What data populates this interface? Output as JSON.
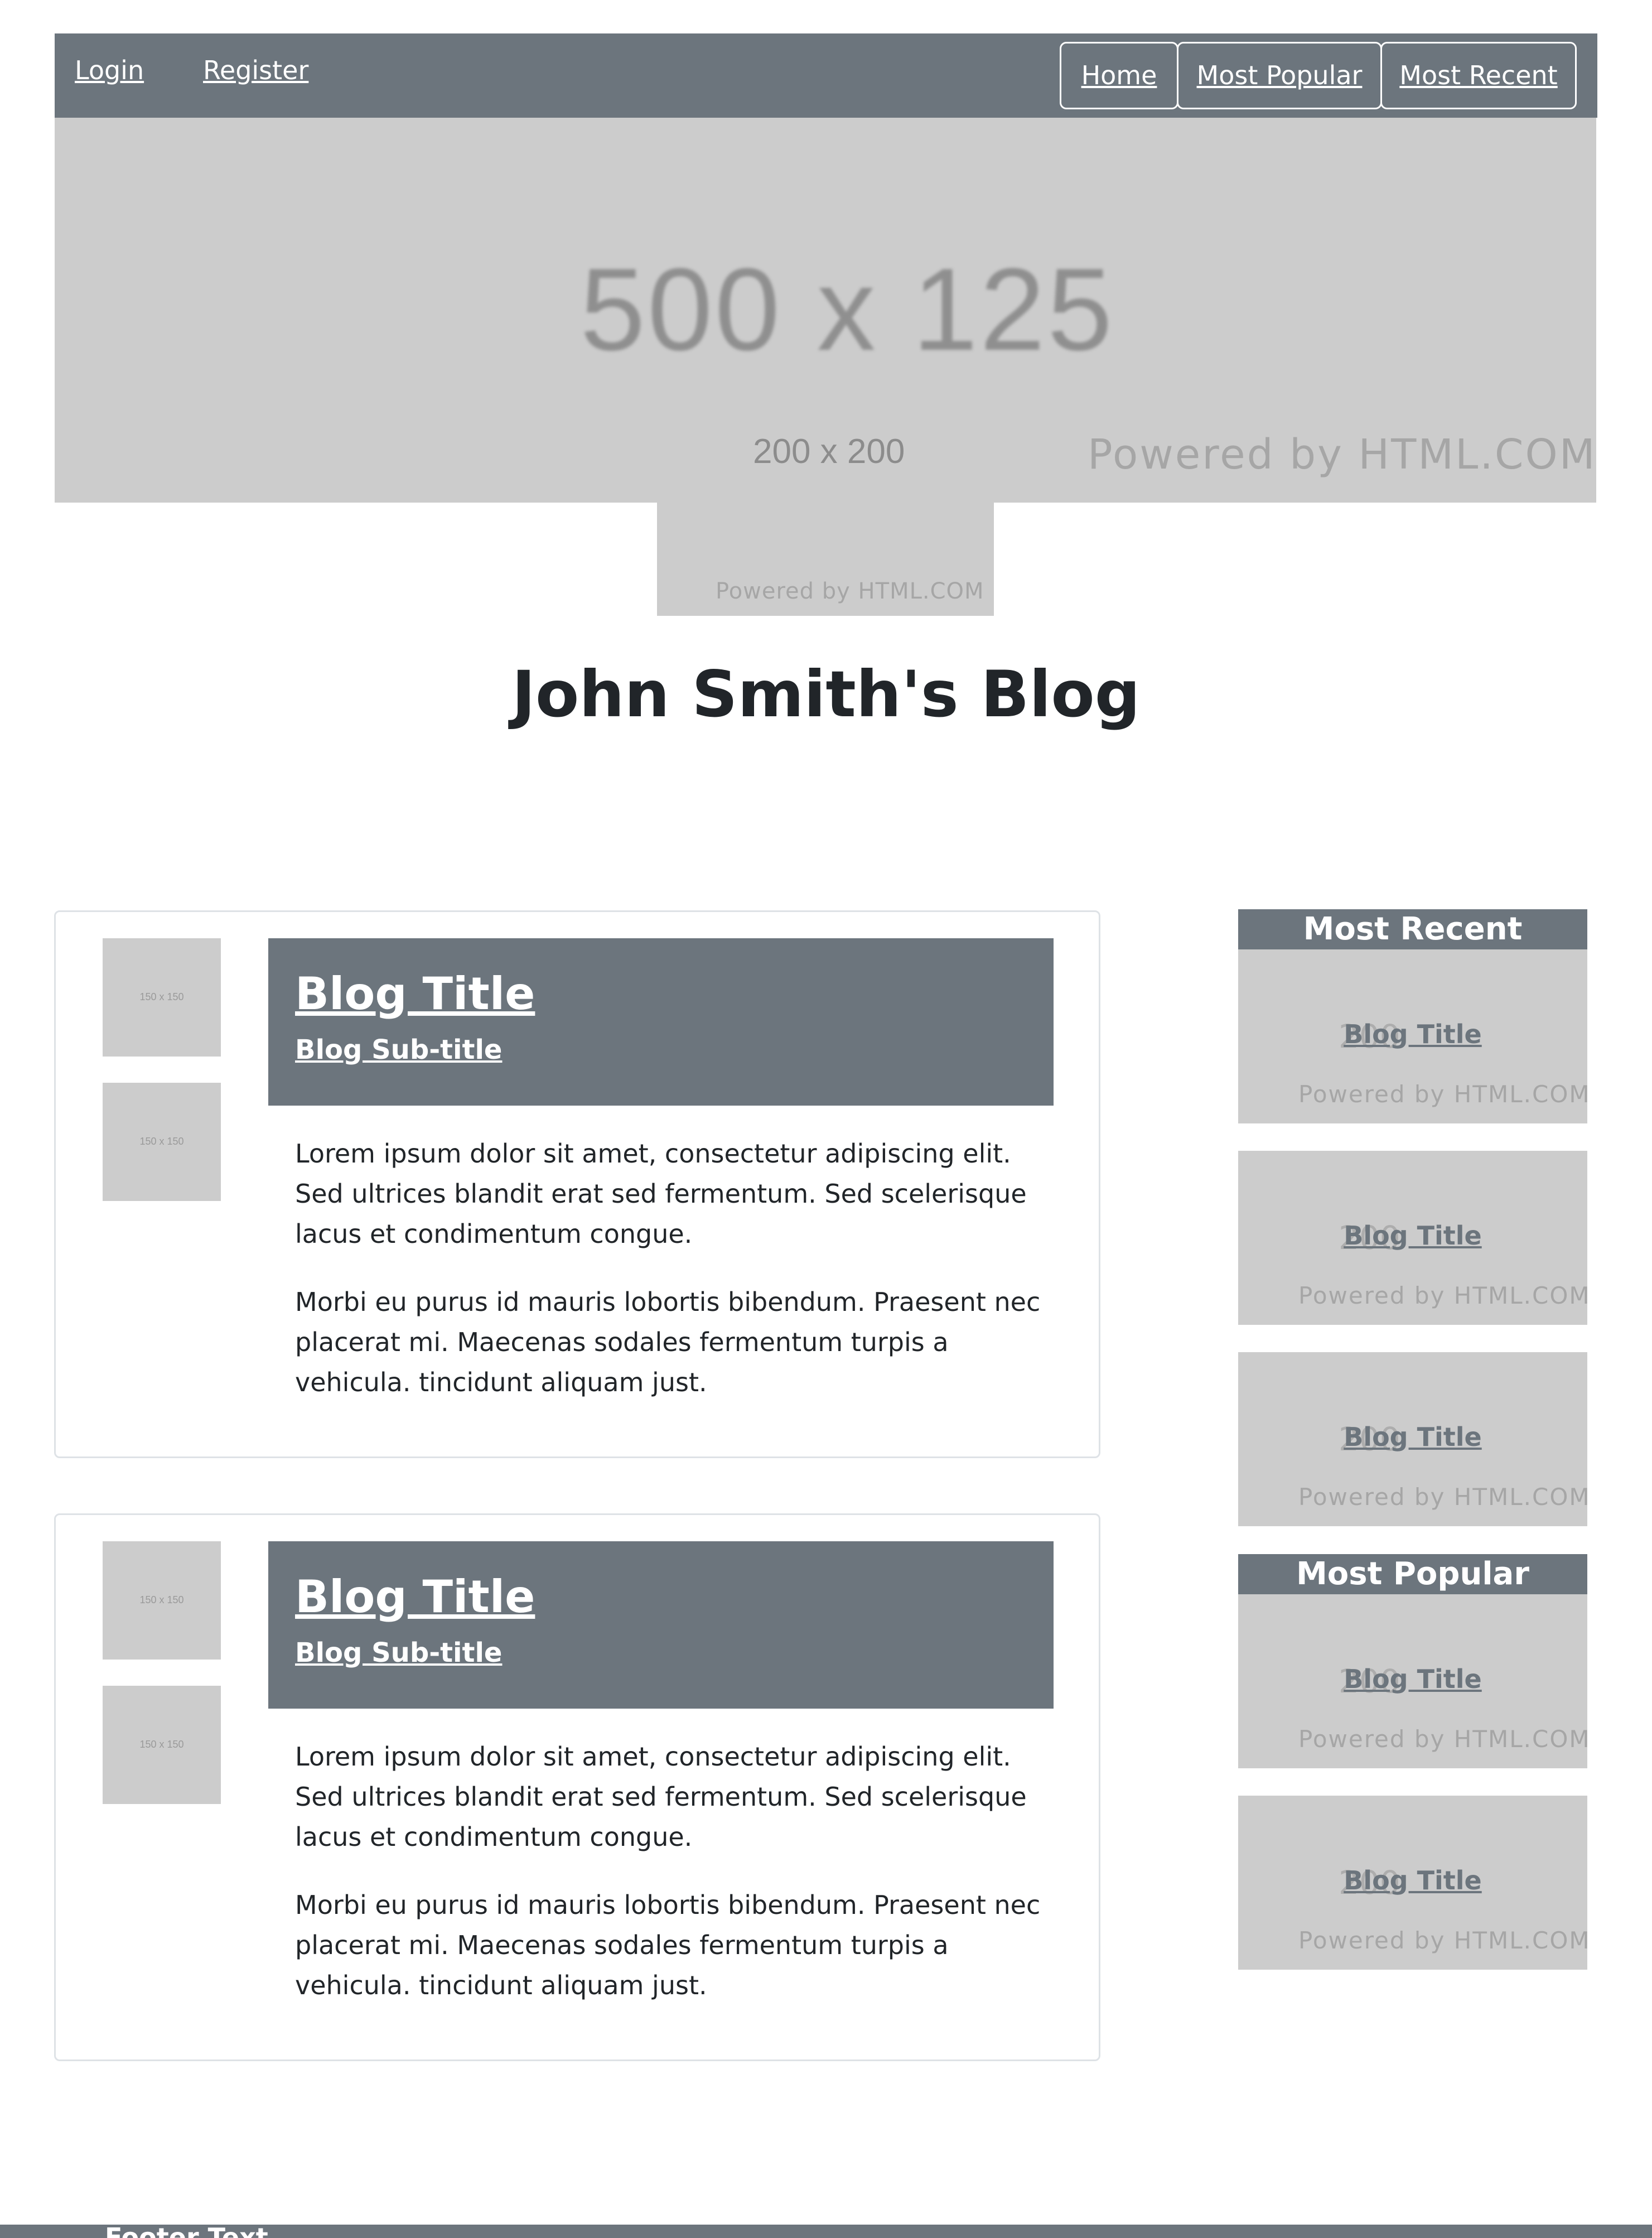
{
  "nav": {
    "login": "Login",
    "register": "Register",
    "home": "Home",
    "most_popular": "Most Popular",
    "most_recent": "Most Recent"
  },
  "hero": {
    "dimensions": "500 x 125",
    "powered": "Powered by HTML.COM"
  },
  "avatar": {
    "dimensions": "200 x 200",
    "powered": "Powered by HTML.COM"
  },
  "site_title": "John Smith's Blog",
  "posts": [
    {
      "thumb_1": "150 x 150",
      "thumb_2": "150 x 150",
      "title": "Blog Title",
      "subtitle": "Blog Sub-title",
      "para_1": "Lorem ipsum dolor sit amet, consectetur adipiscing elit. Sed ultrices blandit erat sed fermentum. Sed scelerisque lacus et condimentum congue.",
      "para_2": "Morbi eu purus id mauris lobortis bibendum. Praesent nec placerat mi. Maecenas sodales fermentum turpis a vehicula. tincidunt aliquam just."
    },
    {
      "thumb_1": "150 x 150",
      "thumb_2": "150 x 150",
      "title": "Blog Title",
      "subtitle": "Blog Sub-title",
      "para_1": "Lorem ipsum dolor sit amet, consectetur adipiscing elit. Sed ultrices blandit erat sed fermentum. Sed scelerisque lacus et condimentum congue.",
      "para_2": "Morbi eu purus id mauris lobortis bibendum. Praesent nec placerat mi. Maecenas sodales fermentum turpis a vehicula. tincidunt aliquam just."
    }
  ],
  "sidebar": {
    "most_recent_heading": "Most Recent",
    "most_popular_heading": "Most Popular",
    "recent": [
      {
        "dimensions": "200",
        "title": "Blog Title",
        "powered": "Powered by HTML.COM"
      },
      {
        "dimensions": "200",
        "title": "Blog Title",
        "powered": "Powered by HTML.COM"
      },
      {
        "dimensions": "200",
        "title": "Blog Title",
        "powered": "Powered by HTML.COM"
      }
    ],
    "popular": [
      {
        "dimensions": "200",
        "title": "Blog Title",
        "powered": "Powered by HTML.COM"
      },
      {
        "dimensions": "200",
        "title": "Blog Title",
        "powered": "Powered by HTML.COM"
      }
    ]
  },
  "footer": {
    "text": "Footer Text"
  },
  "colors": {
    "nav_bg": "#6c757d",
    "placeholder_bg": "#cccccc",
    "text": "#212529"
  }
}
